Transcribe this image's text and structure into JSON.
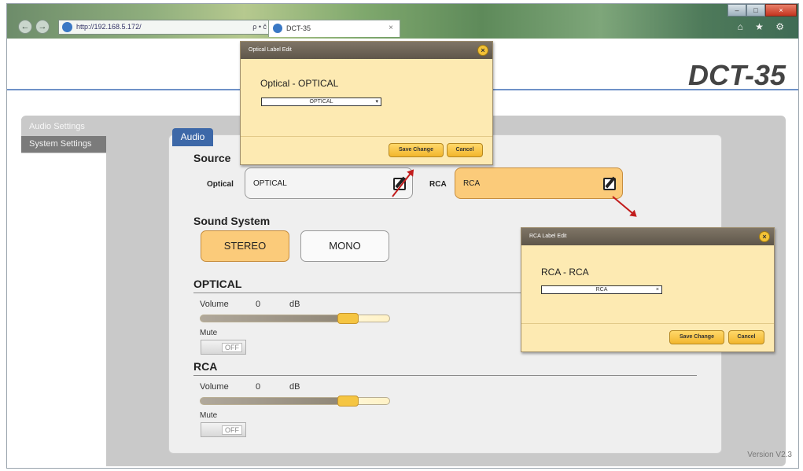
{
  "browser": {
    "address": "http://192.168.5.172/",
    "address_tools": "ρ • č",
    "tab_title": "DCT-35",
    "tab_close": "×",
    "window_min": "–",
    "window_max": "□",
    "window_close": "×",
    "nav_back": "←",
    "nav_forward": "→",
    "toolbar_icons": "⌂ ★ ⚙"
  },
  "page": {
    "title": "DCT-35",
    "version": "Version V2.3"
  },
  "sidebar": {
    "items": [
      {
        "label": "Audio Settings"
      },
      {
        "label": "System Settings"
      }
    ]
  },
  "audio_tab": {
    "label": "Audio"
  },
  "source": {
    "heading": "Source",
    "optical_label": "Optical",
    "optical_value": "OPTICAL",
    "rca_label": "RCA",
    "rca_value": "RCA"
  },
  "sound_system": {
    "heading": "Sound System",
    "stereo_label": "STEREO",
    "mono_label": "MONO",
    "selected": "STEREO"
  },
  "optical_section": {
    "heading": "OPTICAL",
    "volume_label": "Volume",
    "volume_value": "0",
    "volume_unit": "dB",
    "volume_level": 0.78,
    "mute_label": "Mute",
    "mute_state": "OFF"
  },
  "rca_section": {
    "heading": "RCA",
    "volume_label": "Volume",
    "volume_value": "0",
    "volume_unit": "dB",
    "volume_level": 0.78,
    "mute_label": "Mute",
    "mute_state": "OFF"
  },
  "optical_dialog": {
    "bar_title": "Optical Label Edit",
    "title": "Optical - OPTICAL",
    "select_value": "OPTICAL",
    "select_arrow": "▾",
    "close": "×",
    "save_label": "Save Change",
    "cancel_label": "Cancel"
  },
  "rca_dialog": {
    "bar_title": "RCA Label Edit",
    "title": "RCA - RCA",
    "select_value": "RCA",
    "select_arrow": "×",
    "close": "×",
    "save_label": "Save Change",
    "cancel_label": "Cancel"
  },
  "colors": {
    "accent_orange": "#fbcb7a",
    "tab_blue": "#3d68a8",
    "arrow_red": "#c21d1d"
  }
}
